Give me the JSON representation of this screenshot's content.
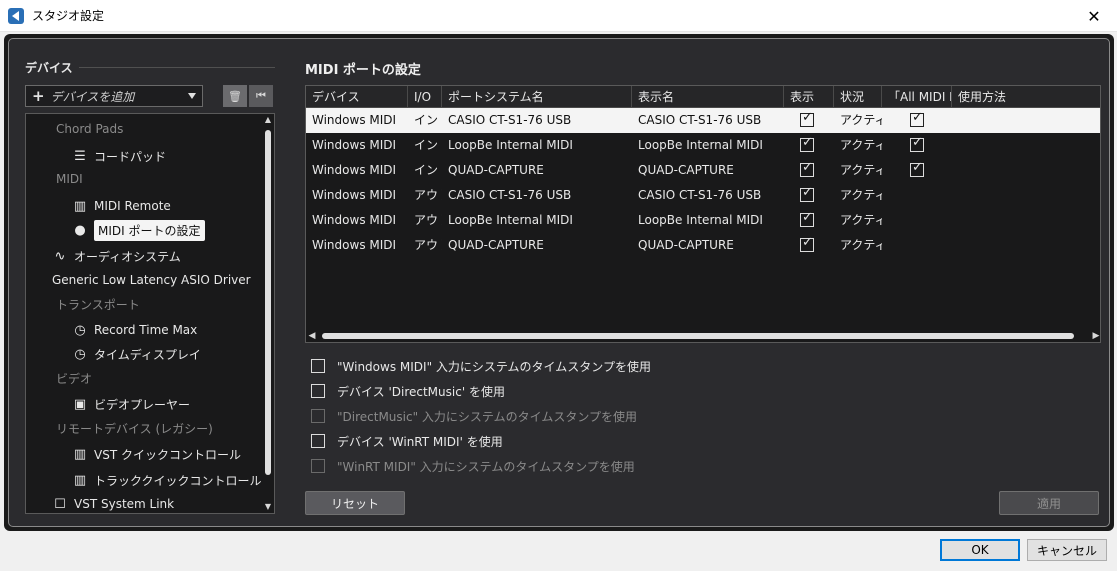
{
  "window": {
    "title": "スタジオ設定",
    "close": "✕"
  },
  "left": {
    "title": "デバイス",
    "add_device": "デバイスを追加",
    "trash_icon": "🗑",
    "rewind_icon": "⏮",
    "tree": [
      {
        "kind": "cat",
        "label": "Chord Pads"
      },
      {
        "kind": "item",
        "label": "コードパッド",
        "icon": "sliders-icon"
      },
      {
        "kind": "cat",
        "label": "MIDI"
      },
      {
        "kind": "item",
        "label": "MIDI Remote",
        "icon": "keyboard-icon"
      },
      {
        "kind": "item",
        "label": "MIDI ポートの設定",
        "icon": "midi-port-icon",
        "selected": true
      },
      {
        "kind": "item1",
        "label": "オーディオシステム",
        "icon": "waveform-icon"
      },
      {
        "kind": "item1",
        "label": "Generic Low Latency ASIO Driver"
      },
      {
        "kind": "cat",
        "label": "トランスポート"
      },
      {
        "kind": "item",
        "label": "Record Time Max",
        "icon": "clock-icon"
      },
      {
        "kind": "item",
        "label": "タイムディスプレイ",
        "icon": "clock-icon"
      },
      {
        "kind": "cat",
        "label": "ビデオ"
      },
      {
        "kind": "item",
        "label": "ビデオプレーヤー",
        "icon": "film-icon"
      },
      {
        "kind": "cat",
        "label": "リモートデバイス (レガシー)"
      },
      {
        "kind": "item",
        "label": "VST クイックコントロール",
        "icon": "keyboard-icon"
      },
      {
        "kind": "item",
        "label": "トラッククイックコントロール",
        "icon": "keyboard-icon"
      },
      {
        "kind": "item1",
        "label": "VST System Link",
        "icon": "checkbox-icon"
      }
    ]
  },
  "right": {
    "title": "MIDI ポートの設定",
    "columns": [
      "デバイス",
      "I/O",
      "ポートシステム名",
      "表示名",
      "表示",
      "状況",
      "「All MIDI I",
      "使用方法"
    ],
    "rows": [
      {
        "device": "Windows MIDI",
        "io": "イン",
        "port": "CASIO CT-S1-76 USB",
        "display": "CASIO CT-S1-76 USB",
        "show": true,
        "status": "アクティブ",
        "all_midi": true,
        "selected": true
      },
      {
        "device": "Windows MIDI",
        "io": "イン",
        "port": "LoopBe Internal MIDI",
        "display": "LoopBe Internal MIDI",
        "show": true,
        "status": "アクティブ",
        "all_midi": true
      },
      {
        "device": "Windows MIDI",
        "io": "イン",
        "port": "QUAD-CAPTURE",
        "display": "QUAD-CAPTURE",
        "show": true,
        "status": "アクティブ",
        "all_midi": true
      },
      {
        "device": "Windows MIDI",
        "io": "アウト",
        "port": "CASIO CT-S1-76 USB",
        "display": "CASIO CT-S1-76 USB",
        "show": true,
        "status": "アクティブ",
        "all_midi": false
      },
      {
        "device": "Windows MIDI",
        "io": "アウト",
        "port": "LoopBe Internal MIDI",
        "display": "LoopBe Internal MIDI",
        "show": true,
        "status": "アクティブ",
        "all_midi": false
      },
      {
        "device": "Windows MIDI",
        "io": "アウト",
        "port": "QUAD-CAPTURE",
        "display": "QUAD-CAPTURE",
        "show": true,
        "status": "アクティブ",
        "all_midi": false
      }
    ],
    "options": [
      {
        "label": "\"Windows MIDI\" 入力にシステムのタイムスタンプを使用",
        "disabled": false
      },
      {
        "label": "デバイス 'DirectMusic' を使用",
        "disabled": false
      },
      {
        "label": "\"DirectMusic\" 入力にシステムのタイムスタンプを使用",
        "disabled": true
      },
      {
        "label": "デバイス 'WinRT MIDI' を使用",
        "disabled": false
      },
      {
        "label": "\"WinRT MIDI\" 入力にシステムのタイムスタンプを使用",
        "disabled": true
      }
    ],
    "reset": "リセット",
    "apply": "適用"
  },
  "footer": {
    "ok": "OK",
    "cancel": "キャンセル"
  }
}
